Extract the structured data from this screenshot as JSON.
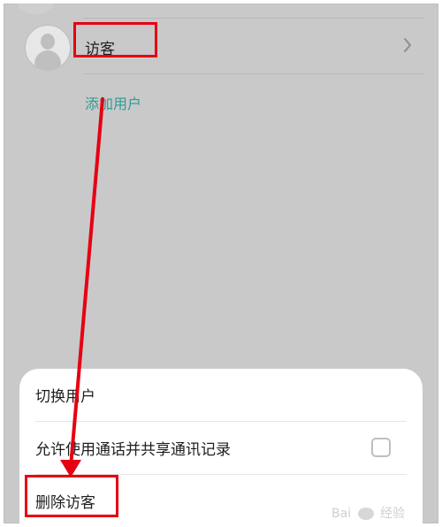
{
  "users": {
    "guest_label": "访客",
    "add_user_label": "添加用户"
  },
  "sheet": {
    "switch_user_label": "切换用户",
    "allow_calls_label": "允许使用通话并共享通讯记录",
    "allow_calls_checked": false,
    "delete_guest_label": "删除访客"
  },
  "watermark": {
    "text_left": "Bai",
    "text_right": "经验"
  },
  "colors": {
    "accent": "#2b9d95",
    "annotation": "#e60012",
    "overlay": "#c9c9c9"
  }
}
